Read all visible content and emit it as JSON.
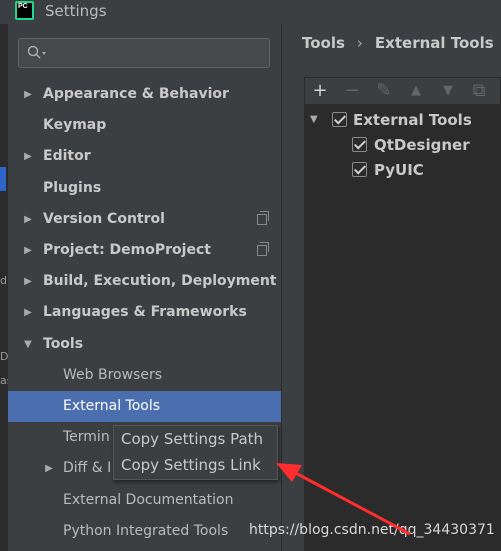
{
  "window": {
    "title": "Settings",
    "logo_text": "PC"
  },
  "left_edge": {
    "chars": [
      "d",
      "De",
      "as"
    ]
  },
  "search": {
    "placeholder": "",
    "icon": "search-icon"
  },
  "tree": [
    {
      "id": "appearance",
      "label": "Appearance & Behavior",
      "expandable": true,
      "expanded": false,
      "level": 0
    },
    {
      "id": "keymap",
      "label": "Keymap",
      "expandable": false,
      "level": 0
    },
    {
      "id": "editor",
      "label": "Editor",
      "expandable": true,
      "expanded": false,
      "level": 0
    },
    {
      "id": "plugins",
      "label": "Plugins",
      "expandable": false,
      "level": 0
    },
    {
      "id": "version-control",
      "label": "Version Control",
      "expandable": true,
      "expanded": false,
      "level": 0,
      "copy_icon": true
    },
    {
      "id": "project",
      "label": "Project: DemoProject",
      "expandable": true,
      "expanded": false,
      "level": 0,
      "copy_icon": true
    },
    {
      "id": "build",
      "label": "Build, Execution, Deployment",
      "expandable": true,
      "expanded": false,
      "level": 0
    },
    {
      "id": "languages",
      "label": "Languages & Frameworks",
      "expandable": true,
      "expanded": false,
      "level": 0
    },
    {
      "id": "tools",
      "label": "Tools",
      "expandable": true,
      "expanded": true,
      "level": 0
    },
    {
      "id": "web-browsers",
      "label": "Web Browsers",
      "level": 1
    },
    {
      "id": "external-tools",
      "label": "External Tools",
      "level": 1,
      "selected": true
    },
    {
      "id": "terminal",
      "label": "Termin",
      "level": 1
    },
    {
      "id": "diff",
      "label": "Diff & I",
      "level": 1,
      "expandable": true,
      "expanded": false
    },
    {
      "id": "external-docs",
      "label": "External Documentation",
      "level": 1
    },
    {
      "id": "python-tools",
      "label": "Python Integrated Tools",
      "level": 1
    }
  ],
  "breadcrumb": {
    "parent": "Tools",
    "separator": "›",
    "current": "External Tools"
  },
  "toolbar": {
    "add": "+",
    "remove": "−",
    "edit": "✎",
    "move_up": "▲",
    "move_down": "▼",
    "copy": "⧉"
  },
  "external_tools": {
    "group": {
      "label": "External Tools",
      "checked": true,
      "expanded": true
    },
    "items": [
      {
        "label": "QtDesigner",
        "checked": true
      },
      {
        "label": "PyUIC",
        "checked": true
      }
    ]
  },
  "context_menu": {
    "items": [
      "Copy Settings Path",
      "Copy Settings Link"
    ]
  },
  "watermark": "https://blog.csdn.net/qq_34430371",
  "colors": {
    "background": "#3c3f41",
    "selection": "#4b6eaf",
    "annotation_arrow": "#ff2d2d"
  }
}
